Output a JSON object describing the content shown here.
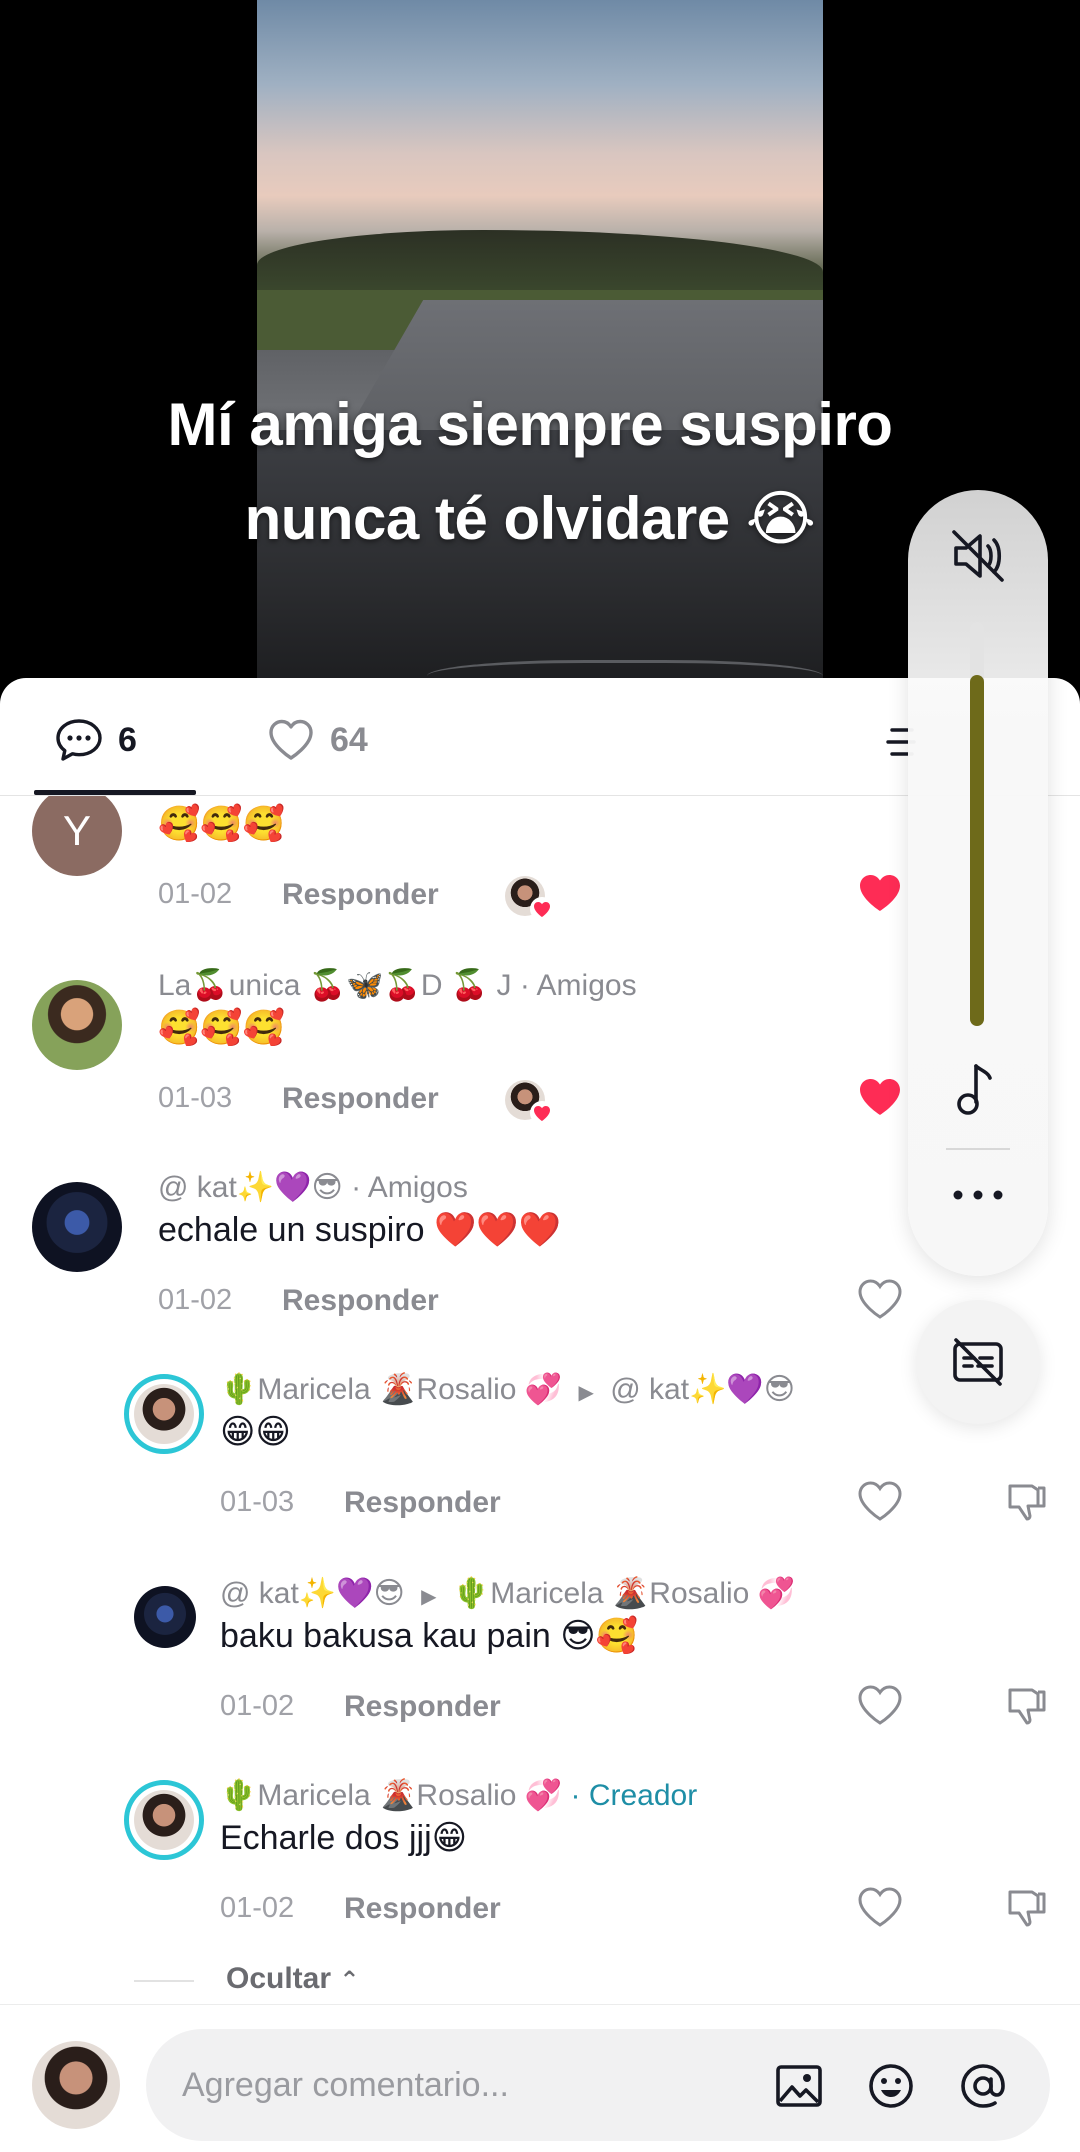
{
  "video": {
    "caption_line1": "Mí amiga siempre suspiro",
    "caption_line2": "nunca té olvidare 😭"
  },
  "tabs": {
    "comments_count": "6",
    "likes_count": "64",
    "active": "comments"
  },
  "comments": [
    {
      "avatar_letter": "Y",
      "text": "🥰🥰🥰",
      "date": "01-02",
      "reply_label": "Responder",
      "liked_by_creator": true,
      "liked": true
    },
    {
      "author": "La🍒unica 🍒🦋🍒D 🍒  J · Amigos",
      "text": "🥰🥰🥰",
      "date": "01-03",
      "reply_label": "Responder",
      "liked_by_creator": true,
      "liked": true
    },
    {
      "author": "@ kat✨💜😎 · Amigos",
      "text": "echale un suspiro ❤️❤️❤️",
      "date": "01-02",
      "reply_label": "Responder",
      "liked": false
    }
  ],
  "replies": [
    {
      "author": "🌵Maricela 🌋Rosalio 💞",
      "reply_to": "@ kat✨💜😎",
      "text": "😁😁",
      "date": "01-03",
      "reply_label": "Responder"
    },
    {
      "author": "@ kat✨💜😎",
      "reply_to": "🌵Maricela 🌋Rosalio 💞",
      "text": "baku bakusa kau pain 😎🥰",
      "date": "01-02",
      "reply_label": "Responder"
    },
    {
      "author": "🌵Maricela 🌋Rosalio 💞",
      "badge": "· Creador",
      "text": "Echarle dos jjj😁",
      "date": "01-02",
      "reply_label": "Responder"
    }
  ],
  "hide_replies_label": "Ocultar",
  "input": {
    "placeholder": "Agregar comentario..."
  },
  "volume": {
    "muted": true,
    "level": 0.87,
    "fill_color": "#6e6a1a"
  },
  "icons": [
    "chat-bubble-icon",
    "heart-outline-icon",
    "heart-filled-icon",
    "dislike-icon",
    "speaker-muted-icon",
    "music-note-icon",
    "more-icon",
    "captions-off-icon",
    "image-icon",
    "emoji-icon",
    "at-icon"
  ],
  "colors": {
    "like_red": "#fe2c55",
    "creator_teal": "#1e8ea6",
    "avatar_ring": "#2cc6d6"
  }
}
